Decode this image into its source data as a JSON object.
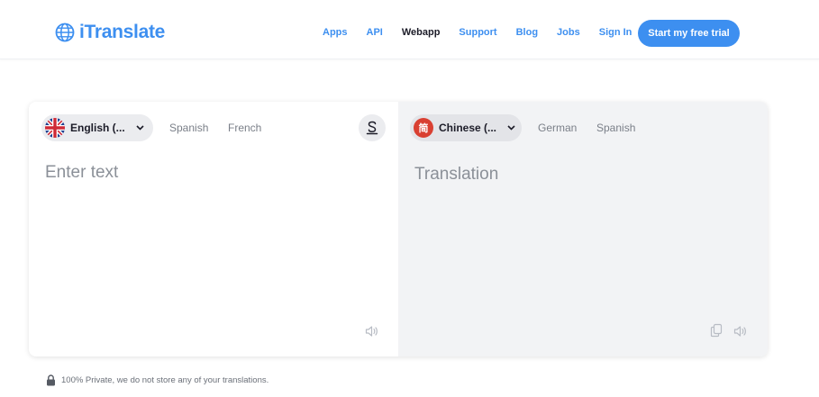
{
  "brand": {
    "name": "iTranslate",
    "color": "#3d8ff0"
  },
  "nav": {
    "items": [
      {
        "label": "Apps"
      },
      {
        "label": "API"
      },
      {
        "label": "Webapp",
        "active": true
      },
      {
        "label": "Support"
      },
      {
        "label": "Blog"
      },
      {
        "label": "Jobs"
      },
      {
        "label": "Sign In"
      }
    ],
    "cta_label": "Start my free trial"
  },
  "source": {
    "selected": "English (...",
    "flag": "uk-flag-icon",
    "quick_langs": [
      "Spanish",
      "French"
    ],
    "placeholder": "Enter text",
    "value": ""
  },
  "swap_icon": "swap-icon",
  "target": {
    "selected": "Chinese (...",
    "flag_char": "简",
    "quick_langs": [
      "German",
      "Spanish"
    ],
    "placeholder": "Translation"
  },
  "footer": {
    "privacy_text": "100% Private, we do not store any of your translations."
  },
  "colors": {
    "accent": "#3d8ff0",
    "target_bg": "#f2f3f5",
    "flag_cn": "#d94032"
  }
}
